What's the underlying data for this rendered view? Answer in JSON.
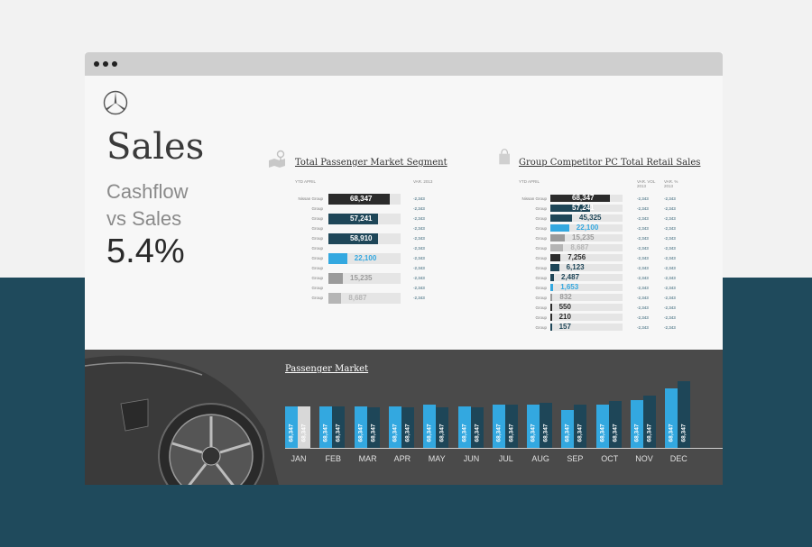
{
  "header": {
    "title": "Sales",
    "subtitle_line1": "Cashflow",
    "subtitle_line2": "vs Sales",
    "metric": "5.4%"
  },
  "left_panel": {
    "title": "Total Passenger Market Segment",
    "col_period": "YTD APRIL",
    "col_var": "VAR. 2013",
    "rows": [
      {
        "label": "Nissan Group",
        "value": "68,347",
        "frac": 0.85,
        "color": "#2b2b2b",
        "var": "-2,343"
      },
      {
        "label": "Group",
        "value": "",
        "frac": 0,
        "color": "#2b2b2b",
        "var": "-2,343"
      },
      {
        "label": "Group",
        "value": "57,241",
        "frac": 0.69,
        "color": "#1e4658",
        "var": "-2,343"
      },
      {
        "label": "Group",
        "value": "",
        "frac": 0,
        "color": "#1e4658",
        "var": "-2,343"
      },
      {
        "label": "Group",
        "value": "58,910",
        "frac": 0.69,
        "color": "#1e4658",
        "var": "-2,343"
      },
      {
        "label": "Group",
        "value": "",
        "frac": 0,
        "color": "#1e4658",
        "var": "-2,343"
      },
      {
        "label": "Group",
        "value": "22,100",
        "frac": 0.26,
        "color": "#33a8e0",
        "var": "-2,343"
      },
      {
        "label": "Group",
        "value": "",
        "frac": 0,
        "color": "#33a8e0",
        "var": "-2,343"
      },
      {
        "label": "Group",
        "value": "15,235",
        "frac": 0.2,
        "color": "#9a9a9a",
        "var": "-2,343"
      },
      {
        "label": "Group",
        "value": "",
        "frac": 0,
        "color": "#9a9a9a",
        "var": "-2,343"
      },
      {
        "label": "Group",
        "value": "8,687",
        "frac": 0.18,
        "color": "#b5b5b5",
        "var": "-2,343"
      }
    ]
  },
  "right_panel": {
    "title": "Group Competitor PC Total Retail Sales",
    "col_period": "YTD APRIL",
    "col_var_vol": "VAR. VOL 2013",
    "col_var_pct": "VAR. % 2013",
    "rows": [
      {
        "label": "Nissan Group",
        "value": "68,347",
        "frac": 0.82,
        "color": "#2b2b2b",
        "var1": "-2,343",
        "var2": "-2,343"
      },
      {
        "label": "Group",
        "value": "57,241",
        "frac": 0.55,
        "color": "#1e4658",
        "var1": "-2,343",
        "var2": "-2,343"
      },
      {
        "label": "Group",
        "value": "45,325",
        "frac": 0.3,
        "color": "#1e4658",
        "var1": "-2,343",
        "var2": "-2,343"
      },
      {
        "label": "Group",
        "value": "22,100",
        "frac": 0.26,
        "color": "#33a8e0",
        "var1": "-2,343",
        "var2": "-2,343"
      },
      {
        "label": "Group",
        "value": "15,235",
        "frac": 0.2,
        "color": "#9a9a9a",
        "var1": "-2,343",
        "var2": "-2,343"
      },
      {
        "label": "Group",
        "value": "8,687",
        "frac": 0.18,
        "color": "#b5b5b5",
        "var1": "-2,343",
        "var2": "-2,343"
      },
      {
        "label": "Group",
        "value": "7,256",
        "frac": 0.14,
        "color": "#2b2b2b",
        "var1": "-2,343",
        "var2": "-2,343"
      },
      {
        "label": "Group",
        "value": "6,123",
        "frac": 0.12,
        "color": "#1e4658",
        "var1": "-2,343",
        "var2": "-2,343"
      },
      {
        "label": "Group",
        "value": "2,487",
        "frac": 0.05,
        "color": "#1e4658",
        "var1": "-2,343",
        "var2": "-2,343"
      },
      {
        "label": "Group",
        "value": "1,653",
        "frac": 0.04,
        "color": "#33a8e0",
        "var1": "-2,343",
        "var2": "-2,343"
      },
      {
        "label": "Group",
        "value": "832",
        "frac": 0.03,
        "color": "#9a9a9a",
        "var1": "-2,343",
        "var2": "-2,343"
      },
      {
        "label": "Group",
        "value": "550",
        "frac": 0.02,
        "color": "#2b2b2b",
        "var1": "-2,343",
        "var2": "-2,343"
      },
      {
        "label": "Group",
        "value": "210",
        "frac": 0.02,
        "color": "#2b2b2b",
        "var1": "-2,343",
        "var2": "-2,343"
      },
      {
        "label": "Group",
        "value": "157",
        "frac": 0.02,
        "color": "#1e4658",
        "var1": "-2,343",
        "var2": "-2,343"
      }
    ]
  },
  "chart_data": {
    "type": "bar",
    "title": "Passenger Market",
    "categories": [
      "JAN",
      "FEB",
      "MAR",
      "APR",
      "MAY",
      "JUN",
      "JUL",
      "AUG",
      "SEP",
      "OCT",
      "NOV",
      "DEC"
    ],
    "series": [
      {
        "values": [
          68347,
          68347,
          68347,
          68347,
          68347,
          68347,
          68347,
          68347,
          68347,
          68347,
          68347,
          68347
        ],
        "labels": [
          "68,347",
          "68,347",
          "68,347",
          "68,347",
          "68,347",
          "68,347",
          "68,347",
          "68,347",
          "68,347",
          "68,347",
          "68,347",
          "68,347"
        ],
        "color": "#33a8e0",
        "first_color": "#33a8e0"
      },
      {
        "values": [
          68347,
          68347,
          68347,
          68347,
          68347,
          68347,
          68347,
          68347,
          68347,
          68347,
          68347,
          68347
        ],
        "labels": [
          "68,347",
          "68,347",
          "68,347",
          "68,347",
          "68,347",
          "68,347",
          "68,347",
          "68,347",
          "68,347",
          "68,347",
          "68,347",
          "68,347"
        ],
        "color": "#1e4658",
        "first_color": "#d8d8d8"
      }
    ],
    "bar_levels": [
      [
        0.58,
        0.58
      ],
      [
        0.58,
        0.58
      ],
      [
        0.58,
        0.56
      ],
      [
        0.58,
        0.56
      ],
      [
        0.6,
        0.56
      ],
      [
        0.58,
        0.56
      ],
      [
        0.6,
        0.6
      ],
      [
        0.6,
        0.63
      ],
      [
        0.52,
        0.6
      ],
      [
        0.6,
        0.65
      ],
      [
        0.66,
        0.72
      ],
      [
        0.82,
        0.92
      ]
    ],
    "colors": {
      "accent": "#33a8e0",
      "dark": "#1e4658",
      "grey": "#9a9a9a"
    }
  },
  "colors": {
    "page_bottom": "#1f4a5c",
    "window": "#f7f7f7",
    "titlebar": "#cfcfcf",
    "chart_bg": "#4a4a4a"
  }
}
